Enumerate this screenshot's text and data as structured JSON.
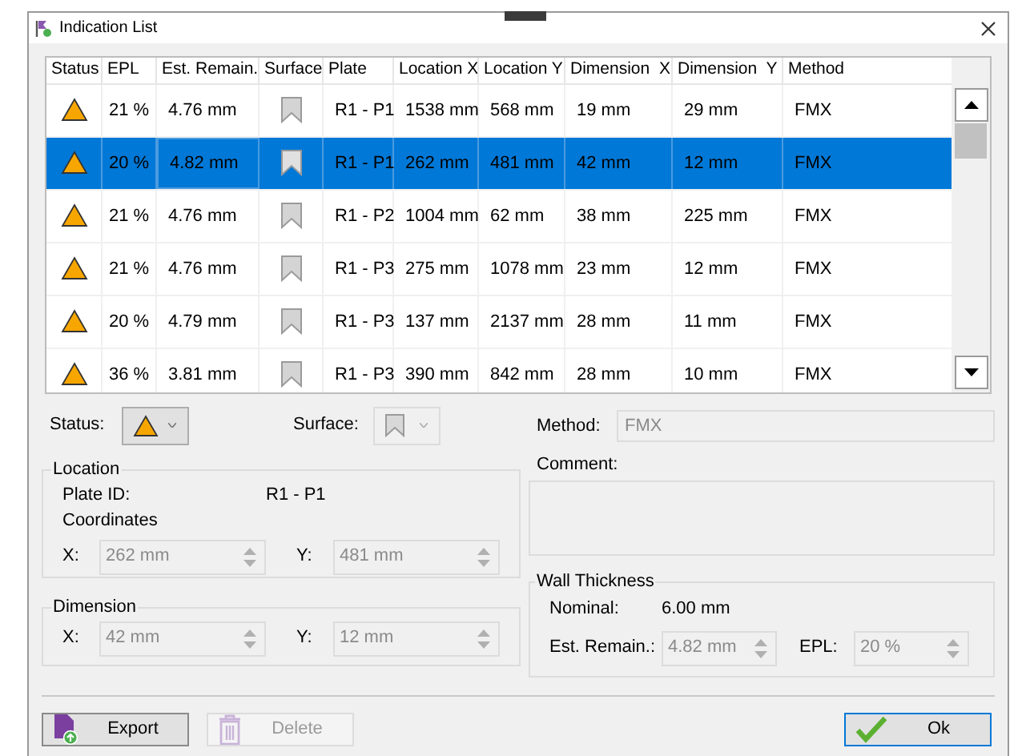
{
  "window": {
    "title": "Indication List"
  },
  "table": {
    "columns": [
      "Status",
      "EPL",
      "Est. Remain.",
      "Surface",
      "Plate",
      "Location X",
      "Location Y",
      "Dimension  X",
      "Dimension  Y",
      "Method"
    ],
    "rows": [
      {
        "epl": "21 %",
        "est_remain": "4.76 mm",
        "plate": "R1 - P1",
        "location_x": "1538 mm",
        "location_y": "568 mm",
        "dimension_x": "19 mm",
        "dimension_y": "29 mm",
        "method": "FMX",
        "selected": false,
        "focused": false
      },
      {
        "epl": "20 %",
        "est_remain": "4.82 mm",
        "plate": "R1 - P1",
        "location_x": "262 mm",
        "location_y": "481 mm",
        "dimension_x": "42 mm",
        "dimension_y": "12 mm",
        "method": "FMX",
        "selected": true,
        "focused": true
      },
      {
        "epl": "21 %",
        "est_remain": "4.76 mm",
        "plate": "R1 - P2",
        "location_x": "1004 mm",
        "location_y": "62 mm",
        "dimension_x": "38 mm",
        "dimension_y": "225 mm",
        "method": "FMX",
        "selected": false,
        "focused": false
      },
      {
        "epl": "21 %",
        "est_remain": "4.76 mm",
        "plate": "R1 - P3",
        "location_x": "275 mm",
        "location_y": "1078 mm",
        "dimension_x": "23 mm",
        "dimension_y": "12 mm",
        "method": "FMX",
        "selected": false,
        "focused": false
      },
      {
        "epl": "20 %",
        "est_remain": "4.79 mm",
        "plate": "R1 - P3",
        "location_x": "137 mm",
        "location_y": "2137 mm",
        "dimension_x": "28 mm",
        "dimension_y": "11 mm",
        "method": "FMX",
        "selected": false,
        "focused": false
      },
      {
        "epl": "36 %",
        "est_remain": "3.81 mm",
        "plate": "R1 - P3",
        "location_x": "390 mm",
        "location_y": "842 mm",
        "dimension_x": "28 mm",
        "dimension_y": "10 mm",
        "method": "FMX",
        "selected": false,
        "focused": false
      }
    ]
  },
  "status_field": {
    "label": "Status:",
    "disabled": false
  },
  "surface_field": {
    "label": "Surface:",
    "disabled": true
  },
  "method_field": {
    "label": "Method:",
    "value": "FMX"
  },
  "comment_field": {
    "label": "Comment:"
  },
  "location": {
    "title": "Location",
    "plate_id_label": "Plate ID:",
    "plate_id": "R1 - P1",
    "coordinates_label": "Coordinates",
    "x": {
      "label": "X:",
      "value": "262 mm"
    },
    "y": {
      "label": "Y:",
      "value": "481 mm"
    }
  },
  "dimension": {
    "title": "Dimension",
    "x": {
      "label": "X:",
      "value": "42 mm"
    },
    "y": {
      "label": "Y:",
      "value": "12 mm"
    }
  },
  "wall_thickness": {
    "title": "Wall Thickness",
    "nominal_label": "Nominal:",
    "nominal": "6.00 mm",
    "est_remain": {
      "label": "Est. Remain.:",
      "value": "4.82 mm"
    },
    "epl": {
      "label": "EPL:",
      "value": "20 %"
    }
  },
  "buttons": [
    {
      "kind": "export",
      "label": "Export",
      "disabled": false,
      "default": false
    },
    {
      "kind": "delete",
      "label": "Delete",
      "disabled": true,
      "default": false
    },
    {
      "kind": "ok",
      "label": "Ok",
      "disabled": false,
      "default": true
    }
  ]
}
